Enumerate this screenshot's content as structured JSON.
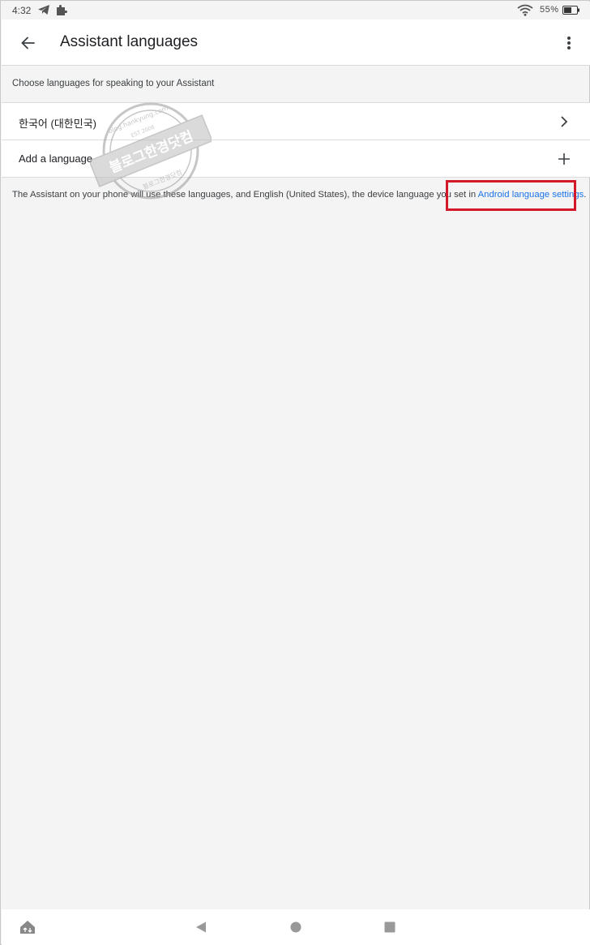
{
  "status_bar": {
    "time": "4:32",
    "battery_percent": "55%",
    "icons": [
      "telegram-icon",
      "puzzle-icon",
      "wifi-icon",
      "battery-icon"
    ]
  },
  "app_bar": {
    "title": "Assistant languages",
    "back_icon": "arrow-back-icon",
    "menu_icon": "more-vert-icon"
  },
  "section": {
    "header": "Choose languages for speaking to your Assistant"
  },
  "languages": [
    {
      "label": "한국어 (대한민국)",
      "icon": "chevron-right-icon"
    },
    {
      "label": "Add a language",
      "icon": "plus-icon"
    }
  ],
  "footnote": {
    "text": "The Assistant on your phone will use these languages, and English (United States), the device language you set in ",
    "link": "Android language settings",
    "trailing": "."
  },
  "watermark": {
    "main": "블로그한경닷컴",
    "top": "blog.hankyung.com",
    "est": "EST 2006"
  },
  "colors": {
    "link": "#1a73e8",
    "highlight": "#d3182a",
    "background": "#f4f4f4"
  }
}
